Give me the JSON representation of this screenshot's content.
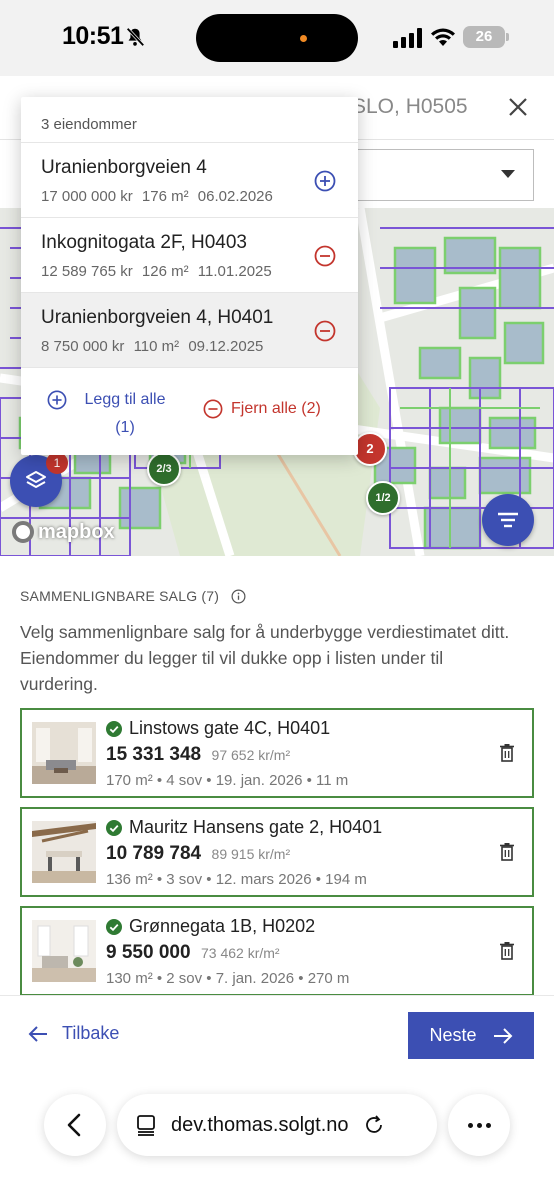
{
  "status_bar": {
    "time": "10:51",
    "battery": "26"
  },
  "header": {
    "title_partial": "SLO, H0505"
  },
  "popover": {
    "count_label": "3 eiendommer",
    "items": [
      {
        "name": "Uranienborgveien 4",
        "price": "17 000 000 kr",
        "area": "176 m²",
        "date": "06.02.2026",
        "action": "add",
        "selected": false
      },
      {
        "name": "Inkognitogata 2F, H0403",
        "price": "12 589 765 kr",
        "area": "126 m²",
        "date": "11.01.2025",
        "action": "remove",
        "selected": false
      },
      {
        "name": "Uranienborgveien 4, H0401",
        "price": "8 750 000 kr",
        "area": "110 m²",
        "date": "09.12.2025",
        "action": "remove",
        "selected": true
      }
    ],
    "add_all_line1": "Legg til alle",
    "add_all_line2": "(1)",
    "remove_all": "Fjern alle (2)"
  },
  "map": {
    "clusters": [
      "2/3",
      "2",
      "1/2"
    ],
    "layers_badge": "1",
    "attribution": "mapbox"
  },
  "section": {
    "label": "SAMMENLIGNBARE SALG (7)",
    "description": "Velg sammenlignbare salg for å underbygge verdiestimatet ditt. Eiendommer du legger til vil dukke opp i listen under til vurdering."
  },
  "sales": [
    {
      "title": "Linstows gate 4C, H0401",
      "price": "15 331 348",
      "ppsqm": "97 652 kr/m²",
      "meta": "170 m² • 4 sov • 19. jan. 2026 • 11 m"
    },
    {
      "title": "Mauritz Hansens gate 2, H0401",
      "price": "10 789 784",
      "ppsqm": "89 915 kr/m²",
      "meta": "136 m² • 3 sov • 12. mars 2026 • 194 m"
    },
    {
      "title": "Grønnegata 1B, H0202",
      "price": "9 550 000",
      "ppsqm": "73 462 kr/m²",
      "meta": "130 m² • 2 sov • 7. jan. 2026 • 270 m"
    }
  ],
  "nav": {
    "back": "Tilbake",
    "next": "Neste"
  },
  "browser": {
    "url": "dev.thomas.solgt.no"
  },
  "colors": {
    "accent": "#3c4fb3",
    "remove": "#c3352d",
    "selected_border": "#4a8c41"
  }
}
